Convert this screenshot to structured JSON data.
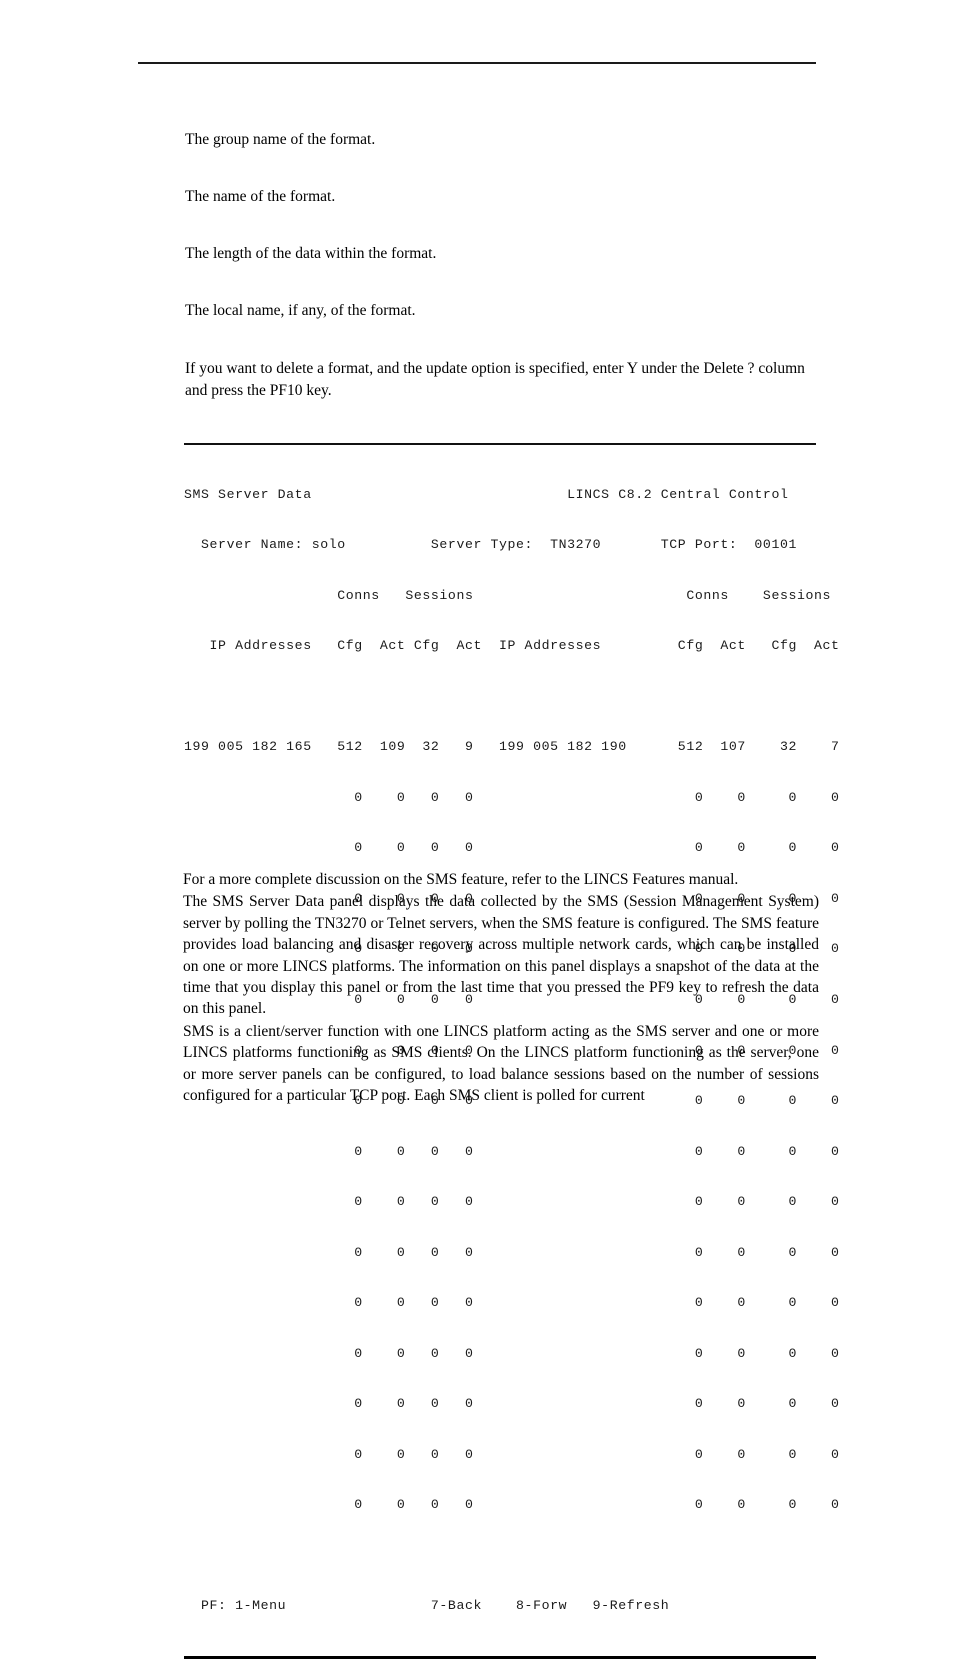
{
  "document": {
    "top_rule": true,
    "descriptions": [
      "The group name of the format.",
      "The name of the format.",
      "The length of the data within the format.",
      "The local name, if any, of the format."
    ],
    "delete_note": "If you want to delete a format, and the update option is specified, enter Y under the Delete ? column and press the PF10 key."
  },
  "panel": {
    "title": "SMS Server Data",
    "system_banner": "LINCS C8.2 Central Control",
    "fields": {
      "server_name_label": "Server Name:",
      "server_name_value": "solo",
      "server_type_label": "Server Type:",
      "server_type_value": "TN3270",
      "tcp_port_label": "TCP Port:",
      "tcp_port_value": "00101"
    },
    "group_headers": [
      "Conns",
      "Sessions"
    ],
    "column_headers": [
      "IP Addresses",
      "Cfg",
      "Act",
      "Cfg",
      "Act"
    ],
    "left_column": {
      "ip_addresses": [
        "199 005 182 165",
        "",
        "",
        "",
        "",
        "",
        "",
        "",
        "",
        "",
        "",
        "",
        "",
        "",
        "",
        ""
      ],
      "conns_cfg": [
        "512",
        "0",
        "0",
        "0",
        "0",
        "0",
        "0",
        "0",
        "0",
        "0",
        "0",
        "0",
        "0",
        "0",
        "0",
        "0"
      ],
      "conns_act": [
        "109",
        "0",
        "0",
        "0",
        "0",
        "0",
        "0",
        "0",
        "0",
        "0",
        "0",
        "0",
        "0",
        "0",
        "0",
        "0"
      ],
      "sessions_cfg": [
        "32",
        "0",
        "0",
        "0",
        "0",
        "0",
        "0",
        "0",
        "0",
        "0",
        "0",
        "0",
        "0",
        "0",
        "0",
        "0"
      ],
      "sessions_act": [
        "9",
        "0",
        "0",
        "0",
        "0",
        "0",
        "0",
        "0",
        "0",
        "0",
        "0",
        "0",
        "0",
        "0",
        "0",
        "0"
      ]
    },
    "right_column": {
      "ip_addresses": [
        "199 005 182 190",
        "",
        "",
        "",
        "",
        "",
        "",
        "",
        "",
        "",
        "",
        "",
        "",
        "",
        "",
        ""
      ],
      "conns_cfg": [
        "512",
        "0",
        "0",
        "0",
        "0",
        "0",
        "0",
        "0",
        "0",
        "0",
        "0",
        "0",
        "0",
        "0",
        "0",
        "0"
      ],
      "conns_act": [
        "107",
        "0",
        "0",
        "0",
        "0",
        "0",
        "0",
        "0",
        "0",
        "0",
        "0",
        "0",
        "0",
        "0",
        "0",
        "0"
      ],
      "sessions_cfg": [
        "32",
        "0",
        "0",
        "0",
        "0",
        "0",
        "0",
        "0",
        "0",
        "0",
        "0",
        "0",
        "0",
        "0",
        "0",
        "0"
      ],
      "sessions_act": [
        "7",
        "0",
        "0",
        "0",
        "0",
        "0",
        "0",
        "0",
        "0",
        "0",
        "0",
        "0",
        "0",
        "0",
        "0",
        "0"
      ]
    },
    "pf_keys": {
      "prefix": "PF:",
      "keys": [
        "1-Menu",
        "7-Back",
        "8-Forw",
        "9-Refresh"
      ]
    },
    "rendered_lines": [
      "SMS Server Data                              LINCS C8.2 Central Control",
      "  Server Name: solo          Server Type:  TN3270       TCP Port:  00101",
      "                  Conns   Sessions                         Conns    Sessions",
      "   IP Addresses   Cfg  Act Cfg  Act  IP Addresses         Cfg  Act   Cfg  Act",
      "",
      "199 005 182 165   512  109  32   9   199 005 182 190      512  107    32    7",
      "                    0    0   0   0                          0    0     0    0",
      "                    0    0   0   0                          0    0     0    0",
      "                    0    0   0   0                          0    0     0    0",
      "                    0    0   0   0                          0    0     0    0",
      "                    0    0   0   0                          0    0     0    0",
      "                    0    0   0   0                          0    0     0    0",
      "                    0    0   0   0                          0    0     0    0",
      "                    0    0   0   0                          0    0     0    0",
      "                    0    0   0   0                          0    0     0    0",
      "                    0    0   0   0                          0    0     0    0",
      "                    0    0   0   0                          0    0     0    0",
      "                    0    0   0   0                          0    0     0    0",
      "                    0    0   0   0                          0    0     0    0",
      "                    0    0   0   0                          0    0     0    0",
      "                    0    0   0   0                          0    0     0    0",
      "",
      "  PF: 1-Menu                 7-Back    8-Forw   9-Refresh"
    ]
  },
  "body": {
    "paragraphs": [
      "For a more complete discussion on the SMS feature, refer to the LINCS Features manual.",
      "The SMS Server Data panel displays the data collected by the SMS (Session Management System) server by polling the TN3270 or Telnet servers, when the SMS feature is configured. The SMS feature provides load balancing and disaster recovery across multiple network cards, which can be installed on one or more LINCS platforms. The information on this panel displays a snapshot of the data at the time that you display this panel or from the last time that you pressed the PF9 key to refresh the data on this panel.",
      "SMS is a client/server function with one LINCS platform acting as the SMS server and one or more LINCS platforms functioning as SMS clients. On the LINCS platform functioning as the server, one or more server panels can be configured, to load balance sessions based on the number of sessions configured for a particular TCP port. Each SMS client is polled for current"
    ]
  }
}
